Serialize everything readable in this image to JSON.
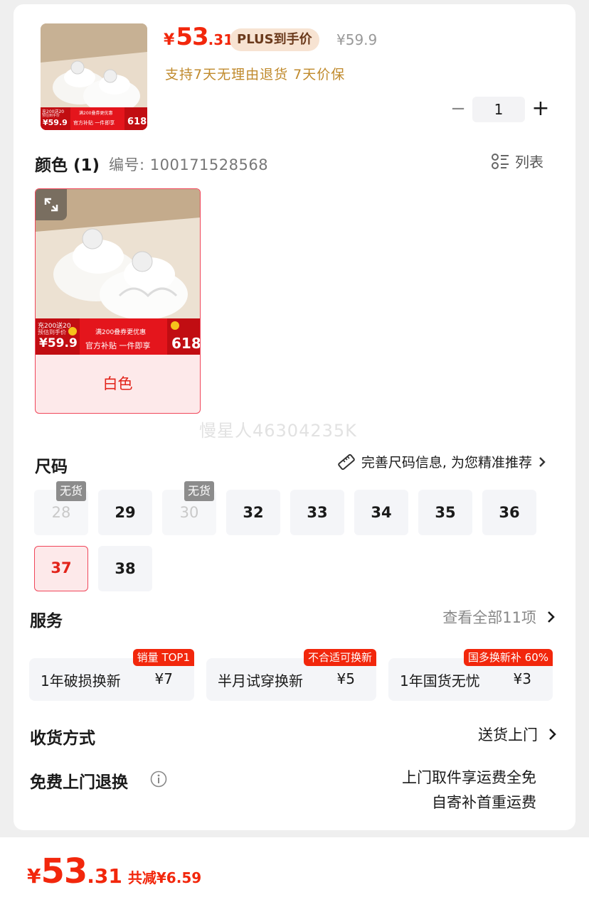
{
  "product": {
    "price_symbol": "¥",
    "price_int": "53",
    "price_dec": ".31",
    "plus_badge": "PLUS到手价",
    "original_price": "¥59.9",
    "promise": "支持7天无理由退货 7天价保",
    "quantity": "1",
    "thumb_banner": {
      "left_top": "充200送20",
      "left_sub": "预估到手价",
      "left_price": "¥59.9",
      "mid_top": "满200叠券更优惠",
      "mid_bottom": "官方补贴 一件即享",
      "right": "618"
    }
  },
  "color_section": {
    "title": "颜色 (1)",
    "code_label": "编号: 100171528568",
    "list_label": "列表",
    "options": [
      {
        "label": "白色",
        "banner": {
          "left_top": "充200送20",
          "left_sub": "预估到手价",
          "left_price": "¥59.9",
          "mid_top": "满200叠券更优惠",
          "mid_bottom": "官方补贴 一件即享",
          "right": "618"
        }
      }
    ]
  },
  "watermark": "慢星人46304235K",
  "size_section": {
    "title": "尺码",
    "guide_label": "完善尺码信息, 为您精准推荐",
    "out_of_stock_label": "无货",
    "sizes": [
      {
        "label": "28",
        "state": "out_of_stock"
      },
      {
        "label": "29",
        "state": "available"
      },
      {
        "label": "30",
        "state": "out_of_stock"
      },
      {
        "label": "32",
        "state": "available"
      },
      {
        "label": "33",
        "state": "available"
      },
      {
        "label": "34",
        "state": "available"
      },
      {
        "label": "35",
        "state": "available"
      },
      {
        "label": "36",
        "state": "available"
      },
      {
        "label": "37",
        "state": "selected"
      },
      {
        "label": "38",
        "state": "available"
      }
    ]
  },
  "service_section": {
    "title": "服务",
    "more_label": "查看全部11项",
    "items": [
      {
        "name": "1年破损换新",
        "price": "¥7",
        "tag": "销量 TOP1"
      },
      {
        "name": "半月试穿换新",
        "price": "¥5",
        "tag": "不合适可换新"
      },
      {
        "name": "1年国货无忧",
        "price": "¥3",
        "tag": "国多换新补 60%"
      }
    ]
  },
  "delivery": {
    "title": "收货方式",
    "value": "送货上门"
  },
  "free_return": {
    "title": "免费上门退换",
    "line1": "上门取件享运费全免",
    "line2": "自寄补首重运费"
  },
  "bottom_bar": {
    "price_symbol": "¥",
    "price_int": "53",
    "price_dec": ".31",
    "saving": "共减¥6.59"
  },
  "colors": {
    "accent": "#f2270c",
    "selected_border": "#f0465a",
    "selected_bg": "#fde9ea",
    "gold": "#c08a2c"
  }
}
